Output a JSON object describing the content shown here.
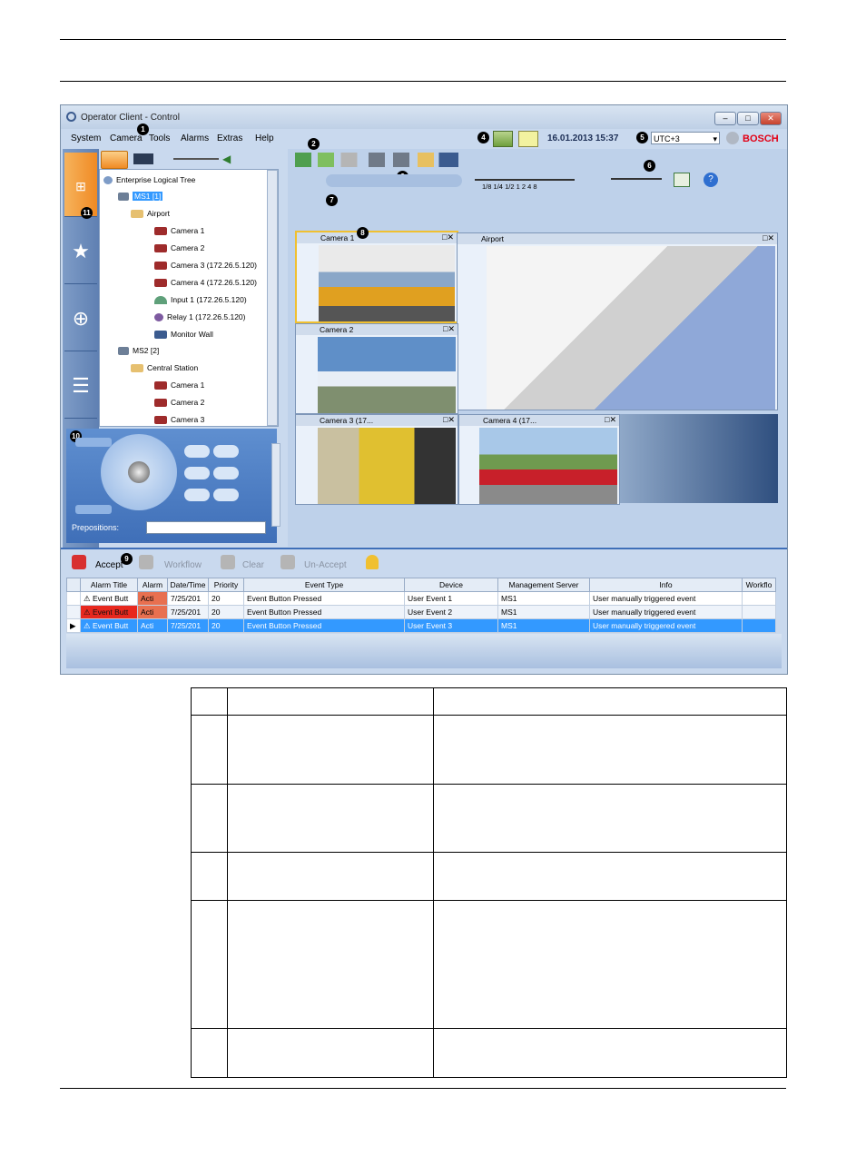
{
  "window": {
    "title": "Operator Client - Control"
  },
  "menu": [
    "System",
    "Camera",
    "Tools",
    "Alarms",
    "Extras",
    "Help"
  ],
  "header": {
    "datetime": "16.01.2013 15:37",
    "timezone": "UTC+3",
    "brand": "BOSCH"
  },
  "callouts": [
    "1",
    "2",
    "3",
    "4",
    "5",
    "6",
    "7",
    "8",
    "9",
    "10",
    "11"
  ],
  "playback": {
    "speeds": [
      "1/8",
      "1/4",
      "1/2",
      "1",
      "2",
      "4",
      "8"
    ]
  },
  "tree": {
    "root": "Enterprise Logical Tree",
    "items": [
      {
        "label": "MS1 [1]"
      },
      {
        "label": "Airport"
      },
      {
        "label": "Camera 1"
      },
      {
        "label": "Camera 2"
      },
      {
        "label": "Camera 3 (172.26.5.120)"
      },
      {
        "label": "Camera 4 (172.26.5.120)"
      },
      {
        "label": "Input 1 (172.26.5.120)"
      },
      {
        "label": "Relay 1 (172.26.5.120)"
      },
      {
        "label": "Monitor Wall"
      },
      {
        "label": "MS2 [2]"
      },
      {
        "label": "Central Station"
      },
      {
        "label": "Camera 1"
      },
      {
        "label": "Camera 2"
      },
      {
        "label": "Camera 3"
      }
    ]
  },
  "ptz": {
    "prepositions_label": "Prepositions:"
  },
  "tiles": {
    "t1": "Camera 1",
    "t2": "Airport",
    "t3": "Camera 2",
    "t4": "Camera 3 (17...",
    "t5": "Camera 4 (17..."
  },
  "alarm_toolbar": {
    "accept": "Accept",
    "workflow": "Workflow",
    "clear": "Clear",
    "unaccept": "Un-Accept"
  },
  "alarm_table": {
    "columns": [
      "Alarm Title",
      "Alarm",
      "Date/Time",
      "Priority",
      "Event Type",
      "Device",
      "Management Server",
      "Info",
      "Workflo"
    ],
    "rows": [
      [
        "Event Butt",
        "Acti",
        "7/25/201",
        "20",
        "Event Button Pressed",
        "User Event 1",
        "MS1",
        "User manually triggered event",
        ""
      ],
      [
        "Event Butt",
        "Acti",
        "7/25/201",
        "20",
        "Event Button Pressed",
        "User Event 2",
        "MS1",
        "User manually triggered event",
        ""
      ],
      [
        "Event Butt",
        "Acti",
        "7/25/201",
        "20",
        "Event Button Pressed",
        "User Event 3",
        "MS1",
        "User manually triggered event",
        ""
      ]
    ]
  },
  "colors": {
    "selection": "#3399ff",
    "alarm_red": "#e8281e",
    "tile_selected": "#f0c030",
    "background": "#c9d9ee"
  }
}
